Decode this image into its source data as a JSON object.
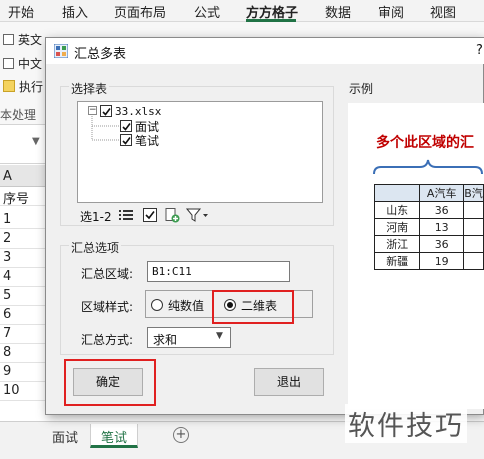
{
  "ribbon": {
    "tabs": [
      "开始",
      "插入",
      "页面布局",
      "公式",
      "方方格子",
      "数据",
      "审阅",
      "视图"
    ],
    "active_tab": "方方格子",
    "items": [
      "英文",
      "中文",
      "执行"
    ],
    "group_label": "本处理"
  },
  "grid": {
    "col_header": "A",
    "header_cell": "序号",
    "row_values": [
      "1",
      "2",
      "3",
      "4",
      "5",
      "6",
      "7",
      "8",
      "9",
      "10"
    ]
  },
  "sheets": {
    "tabs": [
      "面试",
      "笔试"
    ],
    "active": "笔试",
    "add_icon": "plus-circle-icon"
  },
  "dialog": {
    "title": "汇总多表",
    "help": "?",
    "select_group_label": "选择表",
    "tree": {
      "file": "33.xlsx",
      "sheets": [
        "面试",
        "笔试"
      ]
    },
    "toolbar_label": "选1-2",
    "summary_group_label": "汇总选项",
    "range_label": "汇总区域:",
    "range_value": "B1:C11",
    "style_label": "区域样式:",
    "style_options": [
      "纯数值",
      "二维表"
    ],
    "style_selected": "二维表",
    "method_label": "汇总方式:",
    "method_value": "求和",
    "ok_label": "确定",
    "exit_label": "退出"
  },
  "example": {
    "label": "示例",
    "title": "多个此区域的汇",
    "table": {
      "header": [
        "",
        "A汽车",
        "B汽"
      ],
      "rows": [
        [
          "山东",
          "36",
          ""
        ],
        [
          "河南",
          "13",
          ""
        ],
        [
          "浙江",
          "36",
          ""
        ],
        [
          "新疆",
          "19",
          ""
        ]
      ]
    }
  },
  "watermark": "软件技巧",
  "colors": {
    "accent_green": "#217346",
    "highlight_red": "#e02020",
    "example_title_red": "#c00000",
    "table_header_blue": "#dce6f1"
  }
}
